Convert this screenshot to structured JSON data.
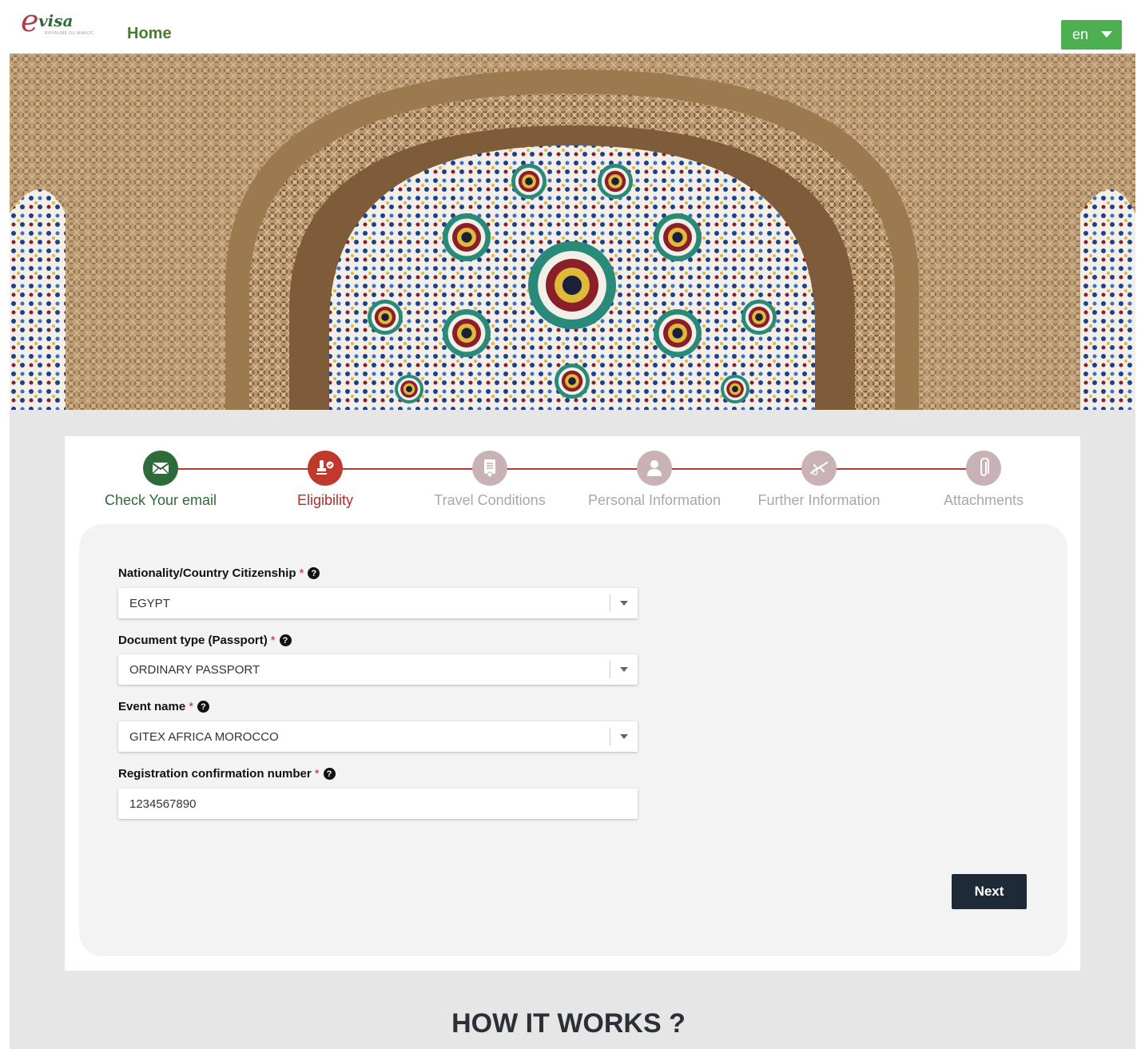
{
  "header": {
    "logo_text": "visa",
    "logo_sub": "ROYAUME DU MAROC",
    "home_label": "Home",
    "language": "en"
  },
  "stepper": {
    "steps": [
      {
        "label": "Check Your email",
        "state": "done",
        "icon": "envelope-icon"
      },
      {
        "label": "Eligibility",
        "state": "active",
        "icon": "stamp-icon"
      },
      {
        "label": "Travel Conditions",
        "state": "pending",
        "icon": "document-icon"
      },
      {
        "label": "Personal Information",
        "state": "pending",
        "icon": "user-icon"
      },
      {
        "label": "Further Information",
        "state": "pending",
        "icon": "airplane-icon"
      },
      {
        "label": "Attachments",
        "state": "pending",
        "icon": "paperclip-icon"
      }
    ]
  },
  "form": {
    "nationality": {
      "label": "Nationality/Country Citizenship",
      "required": "*",
      "value": "EGYPT"
    },
    "document_type": {
      "label": "Document type (Passport)",
      "required": "*",
      "value": "ORDINARY PASSPORT"
    },
    "event_name": {
      "label": "Event name",
      "required": "*",
      "value": "GITEX AFRICA MOROCCO"
    },
    "registration": {
      "label": "Registration confirmation number",
      "required": "*",
      "value": "1234567890"
    },
    "next_label": "Next"
  },
  "how_it_works": {
    "title": "HOW IT WORKS ?"
  },
  "colors": {
    "done": "#2e6b3a",
    "active": "#c0392b",
    "pending": "#c9b2b5",
    "lang_button": "#4caf50",
    "next_button": "#1e2a38"
  }
}
